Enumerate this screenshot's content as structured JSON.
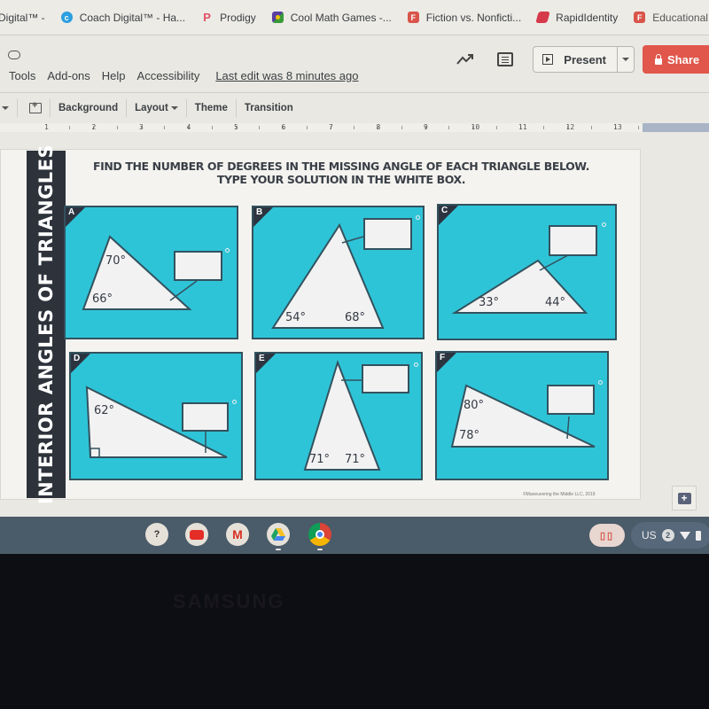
{
  "bookmarks": [
    {
      "label": "Digital™ -",
      "icon": "bookmark-icon",
      "color": "#bbbbbb"
    },
    {
      "label": "Coach Digital™ - Ha...",
      "icon": "coach-digital-icon",
      "color": "#2b9fe0"
    },
    {
      "label": "Prodigy",
      "icon": "prodigy-icon",
      "color": "#e35063"
    },
    {
      "label": "Cool Math Games -...",
      "icon": "coolmath-icon",
      "color": "#5a3fa0"
    },
    {
      "label": "Fiction vs. Nonficti...",
      "icon": "flocabulary-icon",
      "color": "#d9544a"
    },
    {
      "label": "RapidIdentity",
      "icon": "rapididentity-icon",
      "color": "#d63a4a"
    },
    {
      "label": "Educational Hip-Ho...",
      "icon": "flocabulary-icon",
      "color": "#d9544a"
    }
  ],
  "menu": {
    "items": [
      "Tools",
      "Add-ons",
      "Help",
      "Accessibility"
    ],
    "last_edit": "Last edit was 8 minutes ago"
  },
  "header": {
    "present_label": "Present",
    "share_label": "Share",
    "share_color": "#e1574b"
  },
  "toolbar": {
    "background_label": "Background",
    "layout_label": "Layout",
    "theme_label": "Theme",
    "transition_label": "Transition"
  },
  "ruler": {
    "numbers": [
      "1",
      "2",
      "3",
      "4",
      "5",
      "6",
      "7",
      "8",
      "9",
      "10",
      "11",
      "12",
      "13"
    ]
  },
  "slide": {
    "side_title": "INTERIOR ANGLES OF TRIANGLES",
    "instructions_line1": "FIND THE NUMBER OF DEGREES IN THE MISSING ANGLE OF EACH TRIANGLE BELOW.",
    "instructions_line2": "TYPE YOUR SOLUTION IN THE WHITE BOX.",
    "copyright": "©Maneuvering the Middle LLC, 2019",
    "panel_color": "#2ec4d8",
    "problems": [
      {
        "letter": "A",
        "angles": [
          "70°",
          "66°"
        ],
        "answer": ""
      },
      {
        "letter": "B",
        "angles": [
          "54°",
          "68°"
        ],
        "answer": ""
      },
      {
        "letter": "C",
        "angles": [
          "33°",
          "44°"
        ],
        "answer": ""
      },
      {
        "letter": "D",
        "angles": [
          "62°"
        ],
        "right_angle": true,
        "answer": ""
      },
      {
        "letter": "E",
        "angles": [
          "71°",
          "71°"
        ],
        "answer": ""
      },
      {
        "letter": "F",
        "angles": [
          "80°",
          "78°"
        ],
        "answer": ""
      }
    ]
  },
  "shelf": {
    "apps": [
      "coach-app-icon",
      "youtube-icon",
      "gmail-icon",
      "google-drive-icon",
      "chrome-icon"
    ],
    "locale": "US",
    "notification_count": "2"
  },
  "bezel": {
    "brand": "SAMSUNG"
  }
}
